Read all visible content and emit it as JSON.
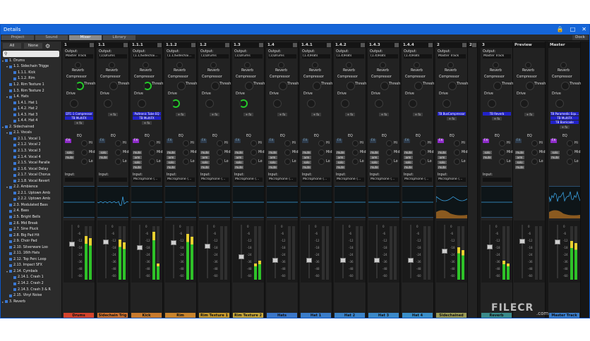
{
  "window": {
    "title": "Details",
    "icons": [
      "lock-icon",
      "restore-icon",
      "close-icon"
    ]
  },
  "tabs": [
    {
      "label": "Project",
      "active": false
    },
    {
      "label": "Sound",
      "active": false
    },
    {
      "label": "Mixer",
      "active": true
    },
    {
      "label": "Library",
      "active": false
    }
  ],
  "dock_label": "Dock",
  "sidebar": {
    "all_label": "All",
    "none_label": "None",
    "search_placeholder": "",
    "tracks": [
      {
        "label": "1. Drums",
        "indent": 0,
        "expander": "minus"
      },
      {
        "label": "1.1. Sidechain Trigge",
        "indent": 1,
        "expander": "minus"
      },
      {
        "label": "1.1.1. Kick",
        "indent": 2
      },
      {
        "label": "1.1.2. Rim",
        "indent": 2
      },
      {
        "label": "1.2. Rim Texture 1",
        "indent": 1
      },
      {
        "label": "1.3. Rim Texture 2",
        "indent": 1
      },
      {
        "label": "1.4. Hats",
        "indent": 1,
        "expander": "minus"
      },
      {
        "label": "1.4.1. Hat 1",
        "indent": 2
      },
      {
        "label": "1.4.2. Hat 2",
        "indent": 2
      },
      {
        "label": "1.4.3. Hat 3",
        "indent": 2
      },
      {
        "label": "1.4.4. Hat 4",
        "indent": 2
      },
      {
        "label": "2. Sidechained",
        "indent": 0,
        "expander": "minus"
      },
      {
        "label": "2.1. Vocals",
        "indent": 1,
        "expander": "minus"
      },
      {
        "label": "2.1.1. Vocal 1",
        "indent": 2
      },
      {
        "label": "2.1.2. Vocal 2",
        "indent": 2
      },
      {
        "label": "2.1.3. Vocal 3",
        "indent": 2
      },
      {
        "label": "2.1.4. Vocal 4",
        "indent": 2
      },
      {
        "label": "2.1.5. Vocal Paralle",
        "indent": 2
      },
      {
        "label": "2.1.6. Vocal Delay",
        "indent": 2
      },
      {
        "label": "2.1.7. Vocal Chorus",
        "indent": 2
      },
      {
        "label": "2.1.8. Vocal Revert",
        "indent": 2
      },
      {
        "label": "2.2. Ambience",
        "indent": 1,
        "expander": "minus"
      },
      {
        "label": "2.2.1. Uptown Amb",
        "indent": 2
      },
      {
        "label": "2.2.2. Uptown Amb",
        "indent": 2
      },
      {
        "label": "2.3. Modulated Bass",
        "indent": 1
      },
      {
        "label": "2.4. Bass",
        "indent": 1
      },
      {
        "label": "2.5. Bright Bells",
        "indent": 1
      },
      {
        "label": "2.6. Mid Break",
        "indent": 1
      },
      {
        "label": "2.7. Sine Pluck",
        "indent": 1
      },
      {
        "label": "2.8. Big Pad Hit",
        "indent": 1
      },
      {
        "label": "2.9. Choir Pad",
        "indent": 1
      },
      {
        "label": "2.10. Silverware Loo",
        "indent": 1
      },
      {
        "label": "2.11. 16th Hats",
        "indent": 1
      },
      {
        "label": "2.12. Top Perc Loop",
        "indent": 1
      },
      {
        "label": "2.13. Impact SFX",
        "indent": 1
      },
      {
        "label": "2.14. Cymbals",
        "indent": 1,
        "expander": "minus"
      },
      {
        "label": "2.14.1. Crash 1",
        "indent": 2
      },
      {
        "label": "2.14.2. Crash 2",
        "indent": 2
      },
      {
        "label": "2.14.3. Crash 3 & R",
        "indent": 2
      },
      {
        "label": "2.15. Vinyl Noise",
        "indent": 1
      },
      {
        "label": "3. Reverb",
        "indent": 0,
        "expander": "plus"
      }
    ]
  },
  "strip_labels": {
    "output": "Output:",
    "reverb": "Reverb",
    "compressor": "Compressor",
    "thresh": "Thresh",
    "drive": "Drive",
    "eq": "EQ",
    "fx": "FX",
    "hi": "Hi",
    "mid": "Mid",
    "lo": "Lo",
    "mute": "mute",
    "solo": "solo",
    "arm": "arm",
    "input": "Input:",
    "add_plugin": "+ fx"
  },
  "db_scale": [
    "0",
    "-6",
    "-12",
    "-18",
    "-24",
    "-36",
    "-48",
    "-60"
  ],
  "strips": [
    {
      "num": "1",
      "output": "Master Track",
      "input": "",
      "name": "Drums",
      "color": "#d2422c",
      "plugins": [
        "DTC-1 Compressor",
        "TB MultiFX"
      ],
      "fx_on": true,
      "fader": 0.66,
      "meter": [
        0.82,
        0.78
      ],
      "scope": "flat"
    },
    {
      "num": "1.1",
      "output": "(1)Drums",
      "input": "",
      "name": "Sidechain Trig",
      "color": "#d0722e",
      "plugins": [],
      "fx_on": false,
      "fader": 0.7,
      "meter": [
        0.75,
        0.7
      ],
      "scope": "spike"
    },
    {
      "num": "1.1.1",
      "output": "(1.1)Sidechai...",
      "input": "Microphone (...",
      "name": "Kick",
      "color": "#c77a2e",
      "plugins": [
        "Pultronic Tube EQ",
        "TB MultiFX"
      ],
      "fx_on": true,
      "fader": 0.58,
      "meter": [
        0.9,
        0.3
      ],
      "scope": "flat"
    },
    {
      "num": "1.1.2",
      "output": "(1.1)Sidechai...",
      "input": "Microphone (...",
      "name": "Rim",
      "color": "#c8842e",
      "plugins": [],
      "fx_on": false,
      "fader": 0.68,
      "meter": [
        0.85,
        0.8
      ],
      "scope": "flat"
    },
    {
      "num": "1.2",
      "output": "(1)Drums",
      "input": "Microphone (...",
      "name": "Rim Texture 1",
      "color": "#c89a2e",
      "plugins": [],
      "fx_on": false,
      "fader": 0.62,
      "meter": [
        0.0,
        0.0
      ],
      "scope": "flat"
    },
    {
      "num": "1.3",
      "output": "(1)Drums",
      "input": "Microphone (...",
      "name": "Rim Texture 2",
      "color": "#c8a83a",
      "plugins": [],
      "fx_on": false,
      "fader": 0.4,
      "meter": [
        0.3,
        0.35
      ],
      "scope": "flat"
    },
    {
      "num": "1.4",
      "output": "(1)Drums",
      "input": "Microphone (...",
      "name": "Hats",
      "color": "#3a76c8",
      "plugins": [],
      "fx_on": false,
      "fader": 0.33,
      "meter": [
        0.0,
        0.0
      ],
      "scope": "flat"
    },
    {
      "num": "1.4.1",
      "output": "(1.4)Hats",
      "input": "Microphone (...",
      "name": "Hat 1",
      "color": "#3a7cc8",
      "plugins": [],
      "fx_on": false,
      "fader": 0.33,
      "meter": [
        0.0,
        0.0
      ],
      "scope": "flat"
    },
    {
      "num": "1.4.2",
      "output": "(1.4)Hats",
      "input": "Microphone (...",
      "name": "Hat 2",
      "color": "#3a82c8",
      "plugins": [],
      "fx_on": false,
      "fader": 0.33,
      "meter": [
        0.0,
        0.0
      ],
      "scope": "flat"
    },
    {
      "num": "1.4.3",
      "output": "(1.4)Hats",
      "input": "Microphone (...",
      "name": "Hat 3",
      "color": "#3a88c8",
      "plugins": [],
      "fx_on": false,
      "fader": 0.33,
      "meter": [
        0.0,
        0.0
      ],
      "scope": "flat"
    },
    {
      "num": "1.4.4",
      "output": "(1.4)Hats",
      "input": "Microphone (...",
      "name": "Hat 4",
      "color": "#3a8ec8",
      "plugins": [],
      "fx_on": false,
      "fader": 0.33,
      "meter": [
        0.0,
        0.0
      ],
      "scope": "flat"
    },
    {
      "num": "2",
      "output": "Master Track",
      "input": "Microphone (...",
      "name": "Sidechained",
      "color": "#9a9a55",
      "plugins": [
        "TB BusCompressor"
      ],
      "fx_on": true,
      "fader": 0.52,
      "meter": [
        0.6,
        0.55
      ],
      "scope": "noise"
    },
    {
      "num": "2.1",
      "output": "(2)Sid",
      "input": "Micro",
      "name": "",
      "color": "#7a9a3a",
      "plugins": [],
      "fx_on": false,
      "fader": 0.5,
      "meter": [
        0.5,
        0.45
      ],
      "scope": "noise"
    },
    {
      "num": "3",
      "output": "Master Track",
      "input": "",
      "name": "Reverb",
      "color": "#3a8a8a",
      "plugins": [
        "TB Reverb"
      ],
      "fx_on": true,
      "fader": 0.6,
      "meter": [
        0.35,
        0.3
      ],
      "scope": "flat"
    },
    {
      "num": "Preview",
      "output": "",
      "input": "",
      "name": "",
      "color": "#222222",
      "plugins": [],
      "fx_on": false,
      "fader": 0.72,
      "meter": [
        0.0,
        0.0
      ],
      "scope": "none"
    },
    {
      "num": "Master",
      "output": "",
      "input": "",
      "name": "Master Track",
      "color": "#3a7cc8",
      "plugins": [
        "TB Paramedic Equ...",
        "TB MultiFX",
        "TB Barricade"
      ],
      "fx_on": true,
      "fader": 0.7,
      "meter": [
        0.72,
        0.68
      ],
      "scope": "wave"
    }
  ],
  "watermark": {
    "text": "FILECR",
    "sub": ".com"
  }
}
